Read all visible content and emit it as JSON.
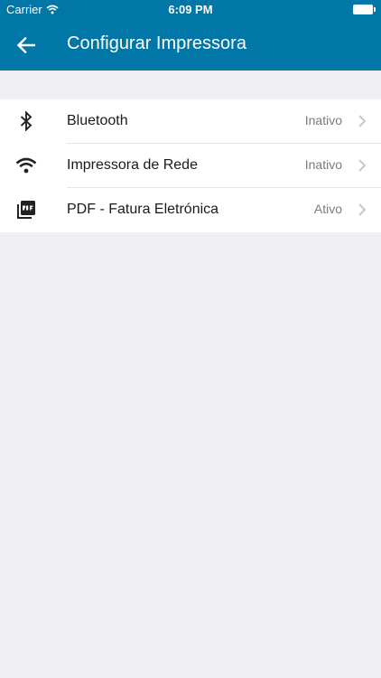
{
  "status_bar": {
    "carrier": "Carrier",
    "time": "6:09 PM"
  },
  "navbar": {
    "title": "Configurar Impressora",
    "background": "#0077a6"
  },
  "printers": [
    {
      "label": "Bluetooth",
      "status": "Inativo",
      "icon": "bluetooth-icon"
    },
    {
      "label": "Impressora de Rede",
      "status": "Inativo",
      "icon": "wifi-icon"
    },
    {
      "label": "PDF - Fatura Eletrónica",
      "status": "Ativo",
      "icon": "pdf-icon"
    }
  ]
}
